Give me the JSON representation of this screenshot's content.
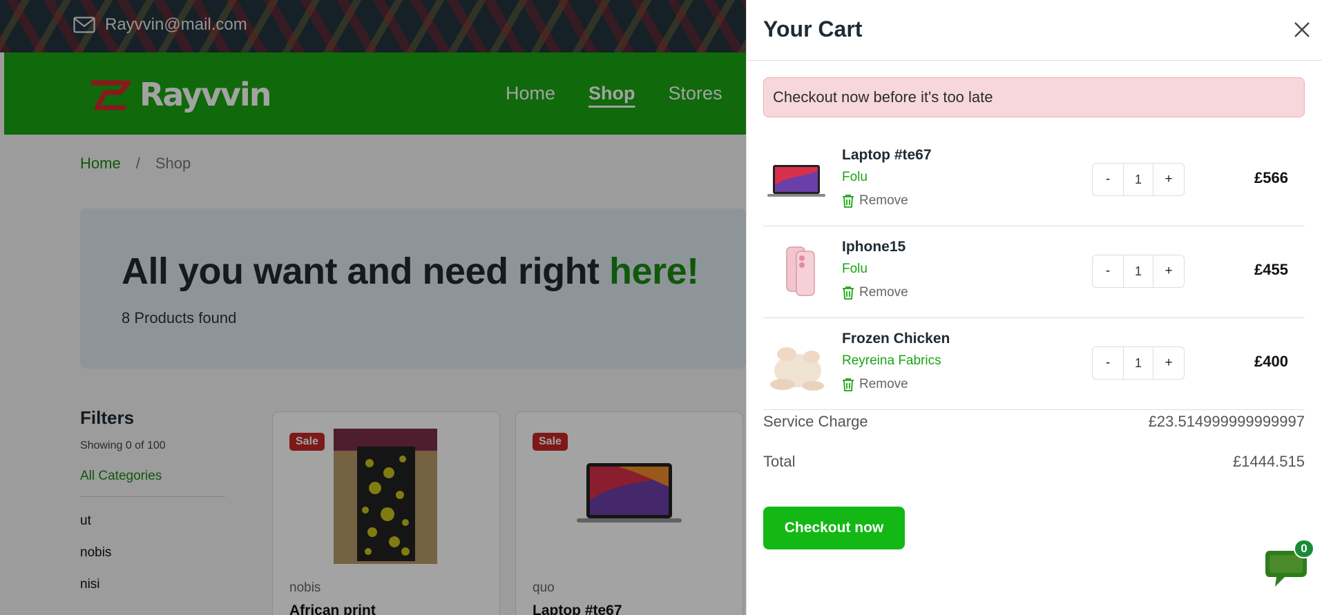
{
  "topbar": {
    "email": "Rayvvin@mail.com"
  },
  "brand": {
    "name": "Rayvvin"
  },
  "nav": {
    "home": "Home",
    "shop": "Shop",
    "stores": "Stores"
  },
  "breadcrumb": {
    "home": "Home",
    "separator": "/",
    "current": "Shop"
  },
  "hero": {
    "title_main": "All you want and need right ",
    "title_highlight": "here!",
    "count": "8",
    "count_label": " Products found"
  },
  "filters": {
    "title": "Filters",
    "showing": "Showing 0 of 100",
    "all_categories": "All Categories",
    "categories": [
      "ut",
      "nobis",
      "nisi"
    ]
  },
  "products": [
    {
      "badge": "Sale",
      "vendor": "nobis",
      "name": "African print"
    },
    {
      "badge": "Sale",
      "vendor": "quo",
      "name": "Laptop #te67"
    }
  ],
  "cart": {
    "title": "Your Cart",
    "alert": "Checkout now before it's too late",
    "remove_label": "Remove",
    "decrement_label": "-",
    "increment_label": "+",
    "items": [
      {
        "name": "Laptop #te67",
        "store": "Folu",
        "qty": "1",
        "price": "£566",
        "icon": "laptop-icon"
      },
      {
        "name": "Iphone15",
        "store": "Folu",
        "qty": "1",
        "price": "£455",
        "icon": "phone-icon"
      },
      {
        "name": "Frozen Chicken",
        "store": "Reyreina Fabrics",
        "qty": "1",
        "price": "£400",
        "icon": "chicken-icon"
      }
    ],
    "service_charge_label": "Service Charge",
    "service_charge_value": "£23.514999999999997",
    "total_label": "Total",
    "total_value": "£1444.515",
    "checkout_label": "Checkout now"
  },
  "chat": {
    "badge": "0"
  },
  "colors": {
    "brand_green": "#19a410",
    "checkout_green": "#13b815",
    "alert_bg": "#f8d7da",
    "sale_red": "#c62828"
  }
}
